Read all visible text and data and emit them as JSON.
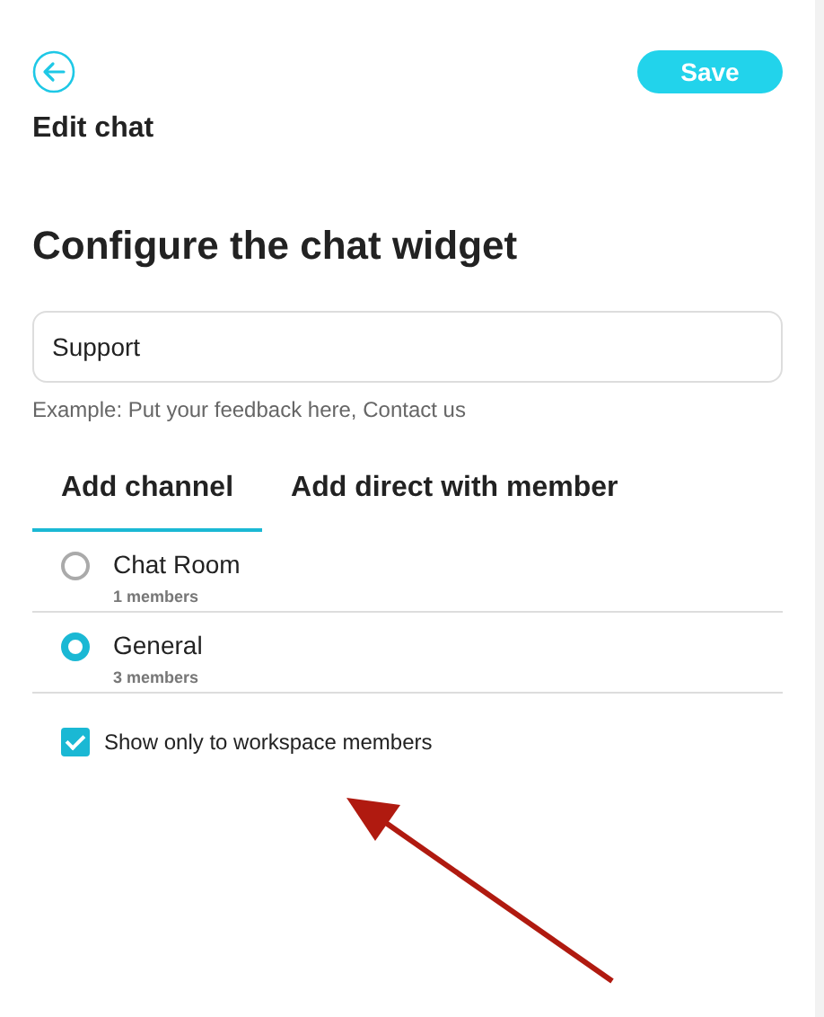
{
  "header": {
    "save_label": "Save",
    "title": "Edit chat"
  },
  "heading": "Configure the chat widget",
  "name_field": {
    "value": "Support",
    "hint": "Example: Put your feedback here, Contact us"
  },
  "tabs": [
    {
      "label": "Add channel",
      "selected": true
    },
    {
      "label": "Add direct with member",
      "selected": false
    }
  ],
  "channels": [
    {
      "name": "Chat Room",
      "members": "1 members",
      "selected": false
    },
    {
      "name": "General",
      "members": "3 members",
      "selected": true
    }
  ],
  "workspace_only": {
    "label": "Show only to workspace members",
    "checked": true
  },
  "annotation": {
    "kind": "arrow"
  }
}
